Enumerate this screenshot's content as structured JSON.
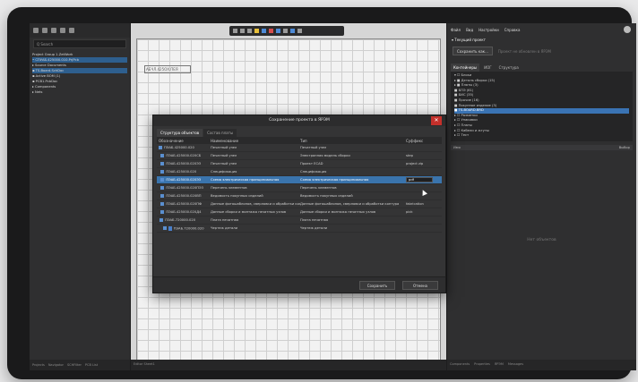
{
  "left": {
    "search": "Q Search",
    "tree": [
      "Project Group 1.ZetWork",
      "• СПУАБ.425000.010.PrjPcb",
      "  ▸ Source Documents",
      "    ▪ TS-Board.SchDoc",
      "    ▪ Active BOM (1)",
      "    ▪ PCB1.PcbDoc",
      "  ▸ Components",
      "  ▸ Nets"
    ],
    "tree_extra": [
      "",
      "",
      "",
      "",
      "= Create",
      ""
    ],
    "bottom_tabs": [
      "Projects",
      "Navigator",
      "SCHFilter",
      "PCB List"
    ]
  },
  "right": {
    "menu": [
      "Файл",
      "Вид",
      "Настройки",
      "Справка"
    ],
    "project_header": "▾ Текущий проект",
    "save_button": "Сохранить как...",
    "note": "Проект не обновлен в ЯРЭМ",
    "tabs": [
      "Контейнеры",
      "ИОГ",
      "Структура"
    ],
    "tree": [
      "▾ ☐ Блоки",
      "   ▸ ■ Деталь сборки (15)",
      "   ▸ ■ Платы (3)",
      "     ■ БПЭ (61)",
      "     ■ БИС (35)",
      "     ■ Прочие (16)",
      "     ■ Покупное изделие (3)",
      "     ■ TS-BOARD.BRD",
      "▸ ☐ Разметки",
      "▸ ☐ Упаковки",
      "▸ ☐ Платы",
      "▸ ☐ Кабели и жгуты",
      "▸ ☐ Тест"
    ],
    "cols": [
      "Имя",
      "Выбор"
    ],
    "empty": "Нет объектов",
    "bottom_tabs": [
      "Components",
      "Properties",
      "ЯРЭМ",
      "Messages"
    ]
  },
  "center": {
    "stamp": "АБЧЛ.425ОХ.ПЕЯ",
    "bottom": "Editor Sheet1"
  },
  "dialog": {
    "title": "Сохранение проекта в ЯРЭМ",
    "tabs": [
      "Структура объектов",
      "Состав платы"
    ],
    "headers": [
      "Обозначение",
      "Наименование",
      "Тип",
      "Суффикс"
    ],
    "rows": [
      {
        "code": "ПЭАБ.425000.020",
        "name": "Печатный узел",
        "type": "Печатный узел",
        "suffix": ""
      },
      {
        "code": "ПЭАБ.425000.020СБ",
        "name": "Печатный узел",
        "type": "Электронная модель сборки",
        "suffix": "step"
      },
      {
        "code": "ПЭАБ.425000.020Э3",
        "name": "Печатный узел",
        "type": "Проект ECAD",
        "suffix": "project zip"
      },
      {
        "code": "ПЭАБ.425000.020",
        "name": "Спецификация",
        "type": "Спецификация",
        "suffix": ""
      },
      {
        "code": "ПЭАБ.425000.020Э3",
        "name": "Схема электрическая принципиальная",
        "type": "Схема электрическая принципиальная",
        "suffix": "pdf"
      },
      {
        "code": "ПЭАБ.425000.020ПЭ3",
        "name": "Перечень элементов",
        "type": "Перечень элементов",
        "suffix": ""
      },
      {
        "code": "ПЭАБ.425000.020ВП",
        "name": "Ведомость покупных изделий",
        "type": "Ведомость покупных изделий",
        "suffix": ""
      },
      {
        "code": "ПЭАБ.425000.020ПФ",
        "name": "Данные фотошаблонов, сверловки и обработки контура",
        "type": "Данные фотошаблонов, сверловки и обработки контура",
        "suffix": "fabrication"
      },
      {
        "code": "ПЭАБ.425000.020Д4",
        "name": "Данные сборки и монтажа печатных узлов",
        "type": "Данные сборки и монтажа печатных узлов",
        "suffix": "pick"
      },
      {
        "code": "ПЭАБ.720000.020",
        "name": "Плата печатная",
        "type": "Плата печатная",
        "suffix": ""
      },
      {
        "code": "ПЭАБ.720000.020",
        "name": "Чертеж детали",
        "type": "Чертеж детали",
        "suffix": ""
      }
    ],
    "save": "Сохранить",
    "cancel": "Отмена"
  }
}
